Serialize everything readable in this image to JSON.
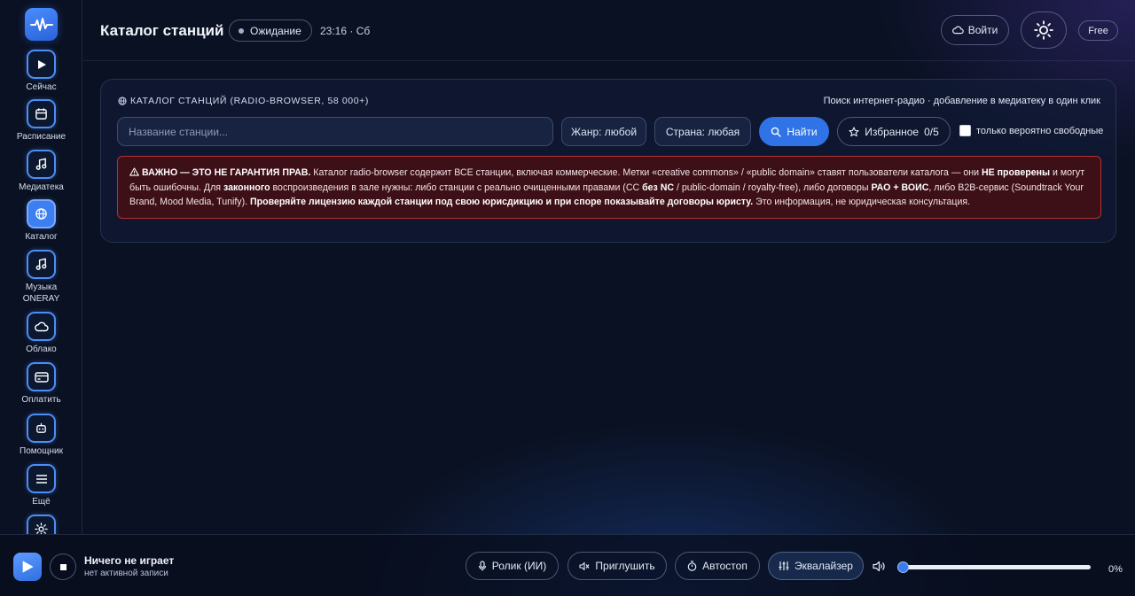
{
  "sidebar": {
    "items": [
      {
        "label": "Сейчас",
        "icon": "play-icon"
      },
      {
        "label": "Расписание",
        "icon": "calendar-icon"
      },
      {
        "label": "Медиатека",
        "icon": "music-note-icon"
      },
      {
        "label": "Каталог",
        "icon": "globe-icon",
        "active": true
      },
      {
        "label": "Музыка\nONERAY",
        "icon": "music-note-icon"
      },
      {
        "label": "Облако",
        "icon": "cloud-icon"
      },
      {
        "label": "Оплатить",
        "icon": "credit-card-icon"
      },
      {
        "label": "Помощник",
        "icon": "robot-icon"
      },
      {
        "label": "Ещё",
        "icon": "menu-icon"
      }
    ]
  },
  "header": {
    "title": "Каталог станций",
    "status": "Ожидание",
    "clock": "23:16 · Сб",
    "login_label": "Войти",
    "plan": "Free"
  },
  "catalog": {
    "title": "КАТАЛОГ СТАНЦИЙ (RADIO-BROWSER, 58 000+)",
    "subtitle": "Поиск интернет-радио · добавление в медиатеку в один клик",
    "search_placeholder": "Название станции...",
    "search_value": "",
    "genre_label": "Жанр: любой",
    "country_label": "Страна: любая",
    "find_label": "Найти",
    "favorites_label": "Избранное",
    "favorites_count": "0/5",
    "free_only_label": "только вероятно свободные",
    "free_only_checked": false
  },
  "warning": {
    "p1": "ВАЖНО — ЭТО НЕ ГАРАНТИЯ ПРАВ.",
    "p2": " Каталог radio-browser содержит ВСЕ станции, включая коммерческие. Метки «creative commons» / «public domain» ставят пользователи каталога — они ",
    "p3": "НЕ проверены",
    "p4": " и могут быть ошибочны. Для ",
    "p5": "законного",
    "p6": " воспроизведения в зале нужны: либо станции с реально очищенными правами (CC ",
    "p7": "без NC",
    "p8": " / public-domain / royalty-free), либо договоры ",
    "p9": "РАО + ВОИС",
    "p10": ", либо B2B-сервис (Soundtrack Your Brand, Mood Media, Tunify). ",
    "p11": "Проверяйте лицензию каждой станции под свою юрисдикцию и при споре показывайте договоры юристу.",
    "p12": " Это информация, не юридическая консультация."
  },
  "player": {
    "now_title": "Ничего не играет",
    "now_sub": "нет активной записи",
    "promo_label": "Ролик (ИИ)",
    "mute_label": "Приглушить",
    "autostop_label": "Автостоп",
    "eq_label": "Эквалайзер",
    "volume_fraction": 0,
    "volume_text": "0%"
  },
  "colors": {
    "accent": "#2f73e6",
    "background": "#0a1122",
    "warning_border": "#b23232",
    "warning_bg": "#3d0f16"
  }
}
